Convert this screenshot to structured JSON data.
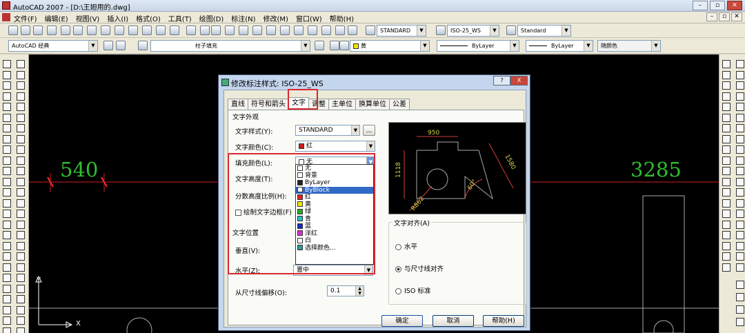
{
  "window": {
    "title": "AutoCAD 2007 - [D:\\王妲用的.dwg]"
  },
  "menu": [
    "文件(F)",
    "编辑(E)",
    "视图(V)",
    "插入(I)",
    "格式(O)",
    "工具(T)",
    "绘图(D)",
    "标注(N)",
    "修改(M)",
    "窗口(W)",
    "帮助(H)"
  ],
  "toolbar1": {
    "text_style": "STANDARD",
    "dim_style": "ISO-25_WS",
    "table_style": "Standard"
  },
  "toolbar2": {
    "workspace": "AutoCAD 经典",
    "layer": "柱子填充",
    "color": "黄",
    "linetype": "ByLayer",
    "lineweight": "ByLayer",
    "plotstyle": "随颜色"
  },
  "drawing": {
    "dim_left": "540",
    "dim_right": "3285",
    "axis_y": "Y",
    "axis_x": "X"
  },
  "dialog": {
    "title": "修改标注样式: ISO-25_WS",
    "help_glyph": "?",
    "close_glyph": "X",
    "tabs": [
      "直线",
      "符号和箭头",
      "文字",
      "调整",
      "主单位",
      "换算单位",
      "公差"
    ],
    "section_appearance": "文字外观",
    "label_text_style": "文字样式(Y):",
    "value_text_style": "STANDARD",
    "browse": "...",
    "label_text_color": "文字颜色(C):",
    "value_text_color": "红",
    "label_fill_color": "填充颜色(L):",
    "value_fill_color": "无",
    "label_text_height": "文字高度(T):",
    "label_fraction_scale": "分数高度比例(H):",
    "label_draw_frame": "绘制文字边框(F)",
    "section_position": "文字位置",
    "label_vertical": "垂直(V):",
    "label_horizontal": "水平(Z):",
    "value_horizontal": "置中",
    "label_offset": "从尺寸线偏移(O):",
    "value_offset": "0.1",
    "section_alignment": "文字对齐(A)",
    "align_options": [
      "水平",
      "与尺寸线对齐",
      "ISO 标准"
    ],
    "align_selected": "与尺寸线对齐",
    "preview": {
      "dim_top": "950",
      "dim_left": "1118",
      "dim_right": "1580",
      "dim_angle": "60°",
      "dim_radius": "R862"
    },
    "btn_ok": "确定",
    "btn_cancel": "取消",
    "btn_help": "帮助(H)"
  },
  "fill_dropdown": {
    "items": [
      {
        "label": "无",
        "color": "#ffffff"
      },
      {
        "label": "背景",
        "color": "#ffffff"
      },
      {
        "label": "ByLayer",
        "color": "#222222"
      },
      {
        "label": "ByBlock",
        "color": "#ffffff"
      },
      {
        "label": "红",
        "color": "#e0201c"
      },
      {
        "label": "黄",
        "color": "#f2e600"
      },
      {
        "label": "绿",
        "color": "#22b022"
      },
      {
        "label": "青",
        "color": "#22c0c8"
      },
      {
        "label": "蓝",
        "color": "#1a2ab8"
      },
      {
        "label": "洋红",
        "color": "#d830c8"
      },
      {
        "label": "白",
        "color": "#ffffff"
      },
      {
        "label": "选择颜色...",
        "color": "#2a9a9a"
      }
    ],
    "selected": "ByBlock"
  },
  "colors": {
    "highlight": "#d8282f",
    "dim_green": "#2fbf2f",
    "dim_red": "#ff2020"
  }
}
